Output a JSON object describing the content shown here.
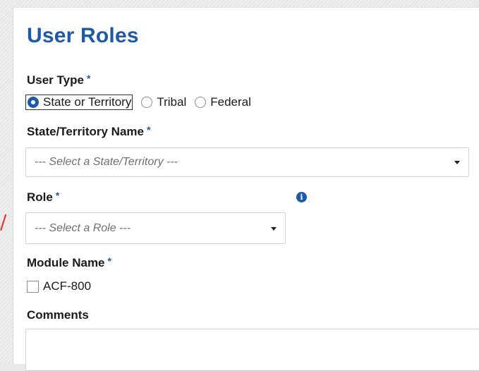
{
  "form": {
    "title": "User Roles",
    "user_type": {
      "label": "User Type",
      "required_mark": "*",
      "options": [
        {
          "label": "State or Territory",
          "selected": true
        },
        {
          "label": "Tribal",
          "selected": false
        },
        {
          "label": "Federal",
          "selected": false
        }
      ]
    },
    "state_territory": {
      "label": "State/Territory Name",
      "required_mark": "*",
      "placeholder": "--- Select a State/Territory ---"
    },
    "role": {
      "label": "Role",
      "required_mark": "*",
      "placeholder": "--- Select a Role ---",
      "info_icon": "info-icon"
    },
    "module_name": {
      "label": "Module Name",
      "required_mark": "*",
      "options": [
        {
          "label": "ACF-800",
          "checked": false
        }
      ]
    },
    "comments": {
      "label": "Comments",
      "value": ""
    }
  },
  "colors": {
    "accent": "#1e5aa8",
    "annotation": "#e53935"
  }
}
